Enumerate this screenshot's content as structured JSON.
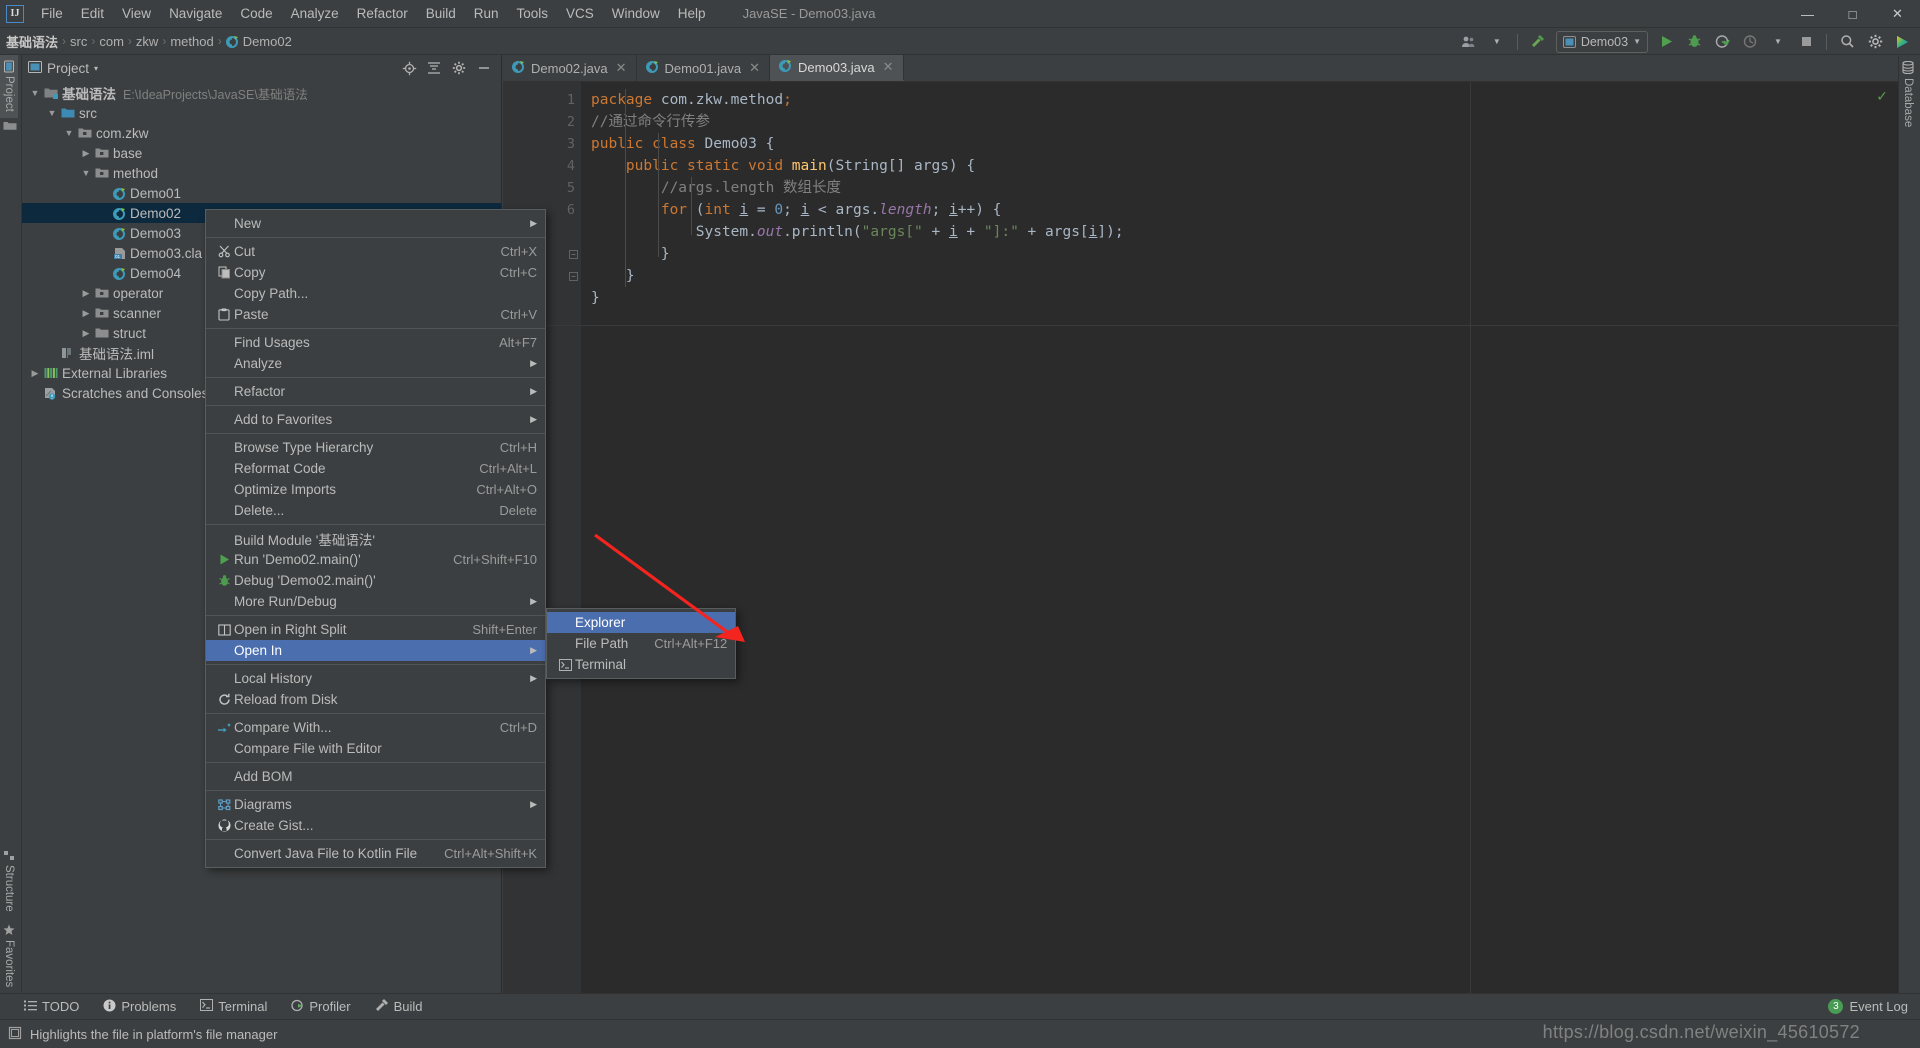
{
  "window": {
    "title": "JavaSE - Demo03.java",
    "logo": "IJ",
    "controls": [
      "minimize",
      "maximize",
      "close"
    ]
  },
  "menubar": {
    "items": [
      {
        "label": "File",
        "mnemonic": "F"
      },
      {
        "label": "Edit",
        "mnemonic": "E"
      },
      {
        "label": "View",
        "mnemonic": "V"
      },
      {
        "label": "Navigate",
        "mnemonic": "N"
      },
      {
        "label": "Code",
        "mnemonic": "C"
      },
      {
        "label": "Analyze",
        "mnemonic": "A"
      },
      {
        "label": "Refactor",
        "mnemonic": "R"
      },
      {
        "label": "Build",
        "mnemonic": "B"
      },
      {
        "label": "Run",
        "mnemonic": "u"
      },
      {
        "label": "Tools",
        "mnemonic": "T"
      },
      {
        "label": "VCS",
        "mnemonic": "S"
      },
      {
        "label": "Window",
        "mnemonic": "W"
      },
      {
        "label": "Help",
        "mnemonic": "H"
      }
    ]
  },
  "breadcrumb": {
    "items": [
      {
        "label": "基础语法",
        "bold": true,
        "icon": ""
      },
      {
        "label": "src",
        "bold": false,
        "icon": ""
      },
      {
        "label": "com",
        "bold": false,
        "icon": ""
      },
      {
        "label": "zkw",
        "bold": false,
        "icon": ""
      },
      {
        "label": "method",
        "bold": false,
        "icon": ""
      },
      {
        "label": "Demo02",
        "bold": false,
        "icon": "java-class-icon"
      }
    ],
    "separator": "›"
  },
  "toolbar": {
    "run_config": "Demo03",
    "buttons": [
      {
        "name": "user-icon",
        "label": ""
      },
      {
        "name": "build-hammer-icon",
        "label": ""
      },
      {
        "name": "run-icon",
        "label": ""
      },
      {
        "name": "debug-icon",
        "label": ""
      },
      {
        "name": "run-with-coverage-icon",
        "label": ""
      },
      {
        "name": "profiler-icon",
        "label": ""
      },
      {
        "name": "stop-icon",
        "label": ""
      },
      {
        "name": "search-everywhere-icon",
        "label": ""
      },
      {
        "name": "settings-gear-icon",
        "label": ""
      },
      {
        "name": "ide-assistant-icon",
        "label": ""
      }
    ]
  },
  "left_strip": {
    "top": [
      {
        "label": "Project",
        "active": true,
        "icon": "project-icon"
      },
      {
        "label": "",
        "icon": "folder-icon"
      }
    ],
    "bottom": [
      {
        "label": "Structure",
        "icon": "structure-icon"
      },
      {
        "label": "Favorites",
        "icon": "star-icon"
      }
    ]
  },
  "right_strip": {
    "items": [
      {
        "label": "Database",
        "icon": "database-icon"
      }
    ]
  },
  "project_panel": {
    "title": "Project",
    "dropdown": "▾",
    "actions": [
      "locate-target-icon",
      "collapse-all-icon",
      "settings-gear-icon",
      "hide-icon"
    ],
    "tree": [
      {
        "depth": 0,
        "arrow": "v",
        "icon": "module-icon",
        "label": "基础语法",
        "bold": true,
        "path": "E:\\IdeaProjects\\JavaSE\\基础语法",
        "selected": false
      },
      {
        "depth": 1,
        "arrow": "v",
        "icon": "source-folder-icon",
        "label": "src",
        "bold": false,
        "path": "",
        "selected": false
      },
      {
        "depth": 2,
        "arrow": "v",
        "icon": "package-icon",
        "label": "com.zkw",
        "bold": false,
        "path": "",
        "selected": false
      },
      {
        "depth": 3,
        "arrow": ">",
        "icon": "package-icon",
        "label": "base",
        "bold": false,
        "path": "",
        "selected": false
      },
      {
        "depth": 3,
        "arrow": "v",
        "icon": "package-icon",
        "label": "method",
        "bold": false,
        "path": "",
        "selected": false
      },
      {
        "depth": 4,
        "arrow": "",
        "icon": "java-class-icon",
        "label": "Demo01",
        "bold": false,
        "path": "",
        "selected": false
      },
      {
        "depth": 4,
        "arrow": "",
        "icon": "java-class-icon",
        "label": "Demo02",
        "bold": false,
        "path": "",
        "selected": true
      },
      {
        "depth": 4,
        "arrow": "",
        "icon": "java-class-icon",
        "label": "Demo03",
        "bold": false,
        "path": "",
        "selected": false
      },
      {
        "depth": 4,
        "arrow": "",
        "icon": "compiled-class-icon",
        "label": "Demo03.cla",
        "bold": false,
        "path": "",
        "selected": false
      },
      {
        "depth": 4,
        "arrow": "",
        "icon": "java-class-icon",
        "label": "Demo04",
        "bold": false,
        "path": "",
        "selected": false
      },
      {
        "depth": 3,
        "arrow": ">",
        "icon": "package-icon",
        "label": "operator",
        "bold": false,
        "path": "",
        "selected": false
      },
      {
        "depth": 3,
        "arrow": ">",
        "icon": "package-icon",
        "label": "scanner",
        "bold": false,
        "path": "",
        "selected": false
      },
      {
        "depth": 3,
        "arrow": ">",
        "icon": "folder-icon",
        "label": "struct",
        "bold": false,
        "path": "",
        "selected": false
      },
      {
        "depth": 1,
        "arrow": "",
        "icon": "iml-file-icon",
        "label": "基础语法.iml",
        "bold": false,
        "path": "",
        "selected": false
      },
      {
        "depth": 0,
        "arrow": ">",
        "icon": "libraries-icon",
        "label": "External Libraries",
        "bold": false,
        "path": "",
        "selected": false
      },
      {
        "depth": 0,
        "arrow": "",
        "icon": "scratches-icon",
        "label": "Scratches and Consoles",
        "bold": false,
        "path": "",
        "selected": false
      }
    ]
  },
  "editor": {
    "tabs": [
      {
        "label": "Demo02.java",
        "active": false,
        "icon": "java-class-icon"
      },
      {
        "label": "Demo01.java",
        "active": false,
        "icon": "java-class-icon"
      },
      {
        "label": "Demo03.java",
        "active": true,
        "icon": "java-class-icon"
      }
    ],
    "line_numbers": [
      "1",
      "2",
      "3",
      "4",
      "5",
      "6"
    ],
    "code_lines": [
      "package com.zkw.method;",
      "//通过命令行传参",
      "public class Demo03 {",
      "    public static void main(String[] args) {",
      "        //args.length 数组长度",
      "        for (int i = 0; i < args.length; i++) {",
      "            System.out.println(\"args[\" + i + \"]:\" + args[i]);",
      "        }",
      "    }",
      "}"
    ],
    "inspection_status": "✓"
  },
  "context_menu": {
    "items": [
      {
        "label": "New",
        "mnemonic": "N",
        "key": "",
        "icon": "",
        "submenu": true,
        "sep_after": true,
        "highlight": false
      },
      {
        "label": "Cut",
        "mnemonic": "C",
        "key": "Ctrl+X",
        "icon": "scissors-icon",
        "submenu": false,
        "sep_after": false,
        "highlight": false
      },
      {
        "label": "Copy",
        "mnemonic": "C",
        "key": "Ctrl+C",
        "icon": "copy-icon",
        "submenu": false,
        "sep_after": false,
        "highlight": false
      },
      {
        "label": "Copy Path...",
        "mnemonic": "",
        "key": "",
        "icon": "",
        "submenu": false,
        "sep_after": false,
        "highlight": false
      },
      {
        "label": "Paste",
        "mnemonic": "P",
        "key": "Ctrl+V",
        "icon": "paste-icon",
        "submenu": false,
        "sep_after": true,
        "highlight": false
      },
      {
        "label": "Find Usages",
        "mnemonic": "U",
        "key": "Alt+F7",
        "icon": "",
        "submenu": false,
        "sep_after": false,
        "highlight": false
      },
      {
        "label": "Analyze",
        "mnemonic": "z",
        "key": "",
        "icon": "",
        "submenu": true,
        "sep_after": true,
        "highlight": false
      },
      {
        "label": "Refactor",
        "mnemonic": "R",
        "key": "",
        "icon": "",
        "submenu": true,
        "sep_after": true,
        "highlight": false
      },
      {
        "label": "Add to Favorites",
        "mnemonic": "F",
        "key": "",
        "icon": "",
        "submenu": true,
        "sep_after": true,
        "highlight": false
      },
      {
        "label": "Browse Type Hierarchy",
        "mnemonic": "",
        "key": "Ctrl+H",
        "icon": "",
        "submenu": false,
        "sep_after": false,
        "highlight": false
      },
      {
        "label": "Reformat Code",
        "mnemonic": "R",
        "key": "Ctrl+Alt+L",
        "icon": "",
        "submenu": false,
        "sep_after": false,
        "highlight": false
      },
      {
        "label": "Optimize Imports",
        "mnemonic": "",
        "key": "Ctrl+Alt+O",
        "icon": "",
        "submenu": false,
        "sep_after": false,
        "highlight": false
      },
      {
        "label": "Delete...",
        "mnemonic": "D",
        "key": "Delete",
        "icon": "",
        "submenu": false,
        "sep_after": true,
        "highlight": false
      },
      {
        "label": "Build Module '基础语法'",
        "mnemonic": "M",
        "key": "",
        "icon": "",
        "submenu": false,
        "sep_after": false,
        "highlight": false
      },
      {
        "label": "Run 'Demo02.main()'",
        "mnemonic": "u",
        "key": "Ctrl+Shift+F10",
        "icon": "run-icon",
        "submenu": false,
        "sep_after": false,
        "highlight": false
      },
      {
        "label": "Debug 'Demo02.main()'",
        "mnemonic": "D",
        "key": "",
        "icon": "debug-icon",
        "submenu": false,
        "sep_after": false,
        "highlight": false
      },
      {
        "label": "More Run/Debug",
        "mnemonic": "",
        "key": "",
        "icon": "",
        "submenu": true,
        "sep_after": true,
        "highlight": false
      },
      {
        "label": "Open in Right Split",
        "mnemonic": "",
        "key": "Shift+Enter",
        "icon": "split-icon",
        "submenu": false,
        "sep_after": false,
        "highlight": false
      },
      {
        "label": "Open In",
        "mnemonic": "",
        "key": "",
        "icon": "",
        "submenu": true,
        "sep_after": true,
        "highlight": true
      },
      {
        "label": "Local History",
        "mnemonic": "H",
        "key": "",
        "icon": "",
        "submenu": true,
        "sep_after": false,
        "highlight": false
      },
      {
        "label": "Reload from Disk",
        "mnemonic": "",
        "key": "",
        "icon": "reload-icon",
        "submenu": false,
        "sep_after": true,
        "highlight": false
      },
      {
        "label": "Compare With...",
        "mnemonic": "",
        "key": "Ctrl+D",
        "icon": "compare-icon",
        "submenu": false,
        "sep_after": false,
        "highlight": false
      },
      {
        "label": "Compare File with Editor",
        "mnemonic": "m",
        "key": "",
        "icon": "",
        "submenu": false,
        "sep_after": true,
        "highlight": false
      },
      {
        "label": "Add BOM",
        "mnemonic": "",
        "key": "",
        "icon": "",
        "submenu": false,
        "sep_after": true,
        "highlight": false
      },
      {
        "label": "Diagrams",
        "mnemonic": "",
        "key": "",
        "icon": "diagram-icon",
        "submenu": true,
        "sep_after": false,
        "highlight": false
      },
      {
        "label": "Create Gist...",
        "mnemonic": "",
        "key": "",
        "icon": "github-icon",
        "submenu": false,
        "sep_after": true,
        "highlight": false
      },
      {
        "label": "Convert Java File to Kotlin File",
        "mnemonic": "",
        "key": "Ctrl+Alt+Shift+K",
        "icon": "",
        "submenu": false,
        "sep_after": false,
        "highlight": false
      }
    ]
  },
  "submenu": {
    "items": [
      {
        "label": "Explorer",
        "key": "",
        "icon": "",
        "highlight": true
      },
      {
        "label": "File Path",
        "mnemonic": "P",
        "key": "Ctrl+Alt+F12",
        "icon": "",
        "highlight": false
      },
      {
        "label": "Terminal",
        "key": "",
        "icon": "terminal-icon",
        "highlight": false
      }
    ]
  },
  "bottom_bar": {
    "items": [
      {
        "label": "TODO",
        "icon": "todo-icon"
      },
      {
        "label": "Problems",
        "icon": "problems-icon"
      },
      {
        "label": "Terminal",
        "icon": "terminal-icon"
      },
      {
        "label": "Profiler",
        "icon": "profiler-icon"
      },
      {
        "label": "Build",
        "icon": "build-hammer-icon"
      }
    ],
    "event_log": {
      "label": "Event Log",
      "count": "3"
    }
  },
  "statusbar": {
    "hint": "Highlights the file in platform's file manager",
    "icon": "info-icon"
  },
  "watermark": "https://blog.csdn.net/weixin_45610572",
  "colors": {
    "accent": "#4b6eaf",
    "selection": "#0d293e",
    "editor_bg": "#2b2b2b",
    "panel_bg": "#3c3f41",
    "annotation_arrow": "#f4241f"
  }
}
